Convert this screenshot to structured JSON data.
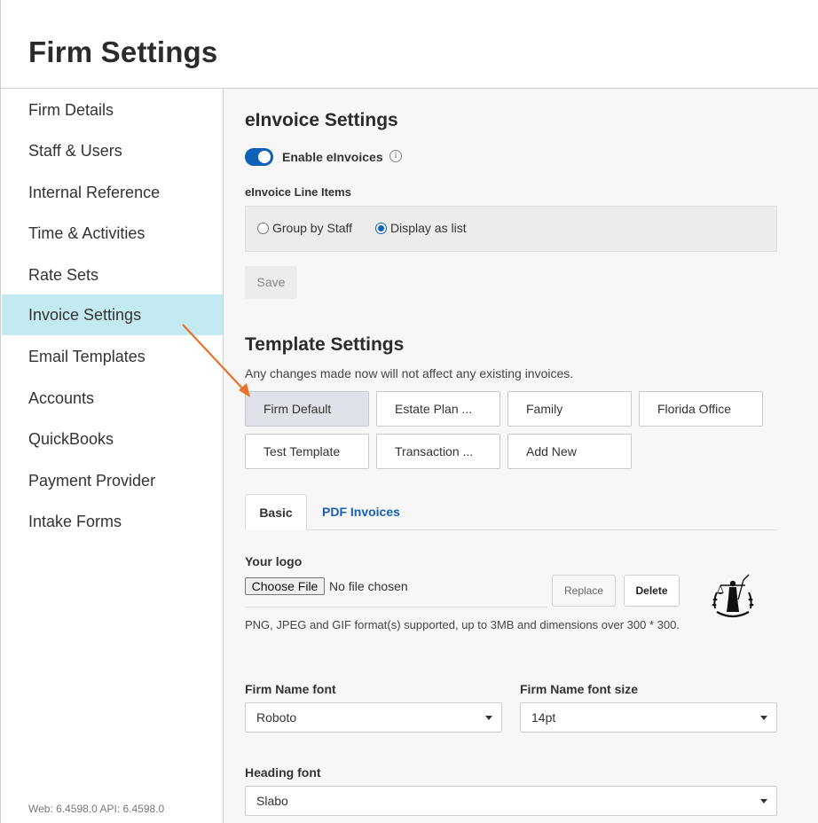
{
  "header": {
    "title": "Firm Settings"
  },
  "sidebar": {
    "items": [
      {
        "label": "Firm Details",
        "active": false
      },
      {
        "label": "Staff & Users",
        "active": false
      },
      {
        "label": "Internal Reference",
        "active": false
      },
      {
        "label": "Time & Activities",
        "active": false
      },
      {
        "label": "Rate Sets",
        "active": false
      },
      {
        "label": "Invoice Settings",
        "active": true
      },
      {
        "label": "Email Templates",
        "active": false
      },
      {
        "label": "Accounts",
        "active": false
      },
      {
        "label": "QuickBooks",
        "active": false
      },
      {
        "label": "Payment Provider",
        "active": false
      },
      {
        "label": "Intake Forms",
        "active": false
      }
    ],
    "version": "Web: 6.4598.0 API: 6.4598.0"
  },
  "einvoice": {
    "title": "eInvoice Settings",
    "enable_label": "Enable eInvoices",
    "enabled": true,
    "info_icon": "info-icon",
    "line_items_label": "eInvoice Line Items",
    "options": [
      {
        "label": "Group by Staff",
        "checked": false
      },
      {
        "label": "Display as list",
        "checked": true
      }
    ],
    "save_label": "Save"
  },
  "templates": {
    "title": "Template Settings",
    "note": "Any changes made now will not affect any existing invoices.",
    "buttons": [
      "Firm Default",
      "Estate Plan ...",
      "Family",
      "Florida Office",
      "Test Template",
      "Transaction ...",
      "Add New"
    ],
    "selected": "Firm Default"
  },
  "tabs": [
    {
      "label": "Basic",
      "active": true
    },
    {
      "label": "PDF Invoices",
      "active": false
    }
  ],
  "logo": {
    "label": "Your logo",
    "choose_label": "Choose File",
    "file_status": "No file chosen",
    "replace_label": "Replace",
    "delete_label": "Delete",
    "hint": "PNG, JPEG and GIF format(s) supported, up to 3MB and dimensions over 300 * 300."
  },
  "fonts": {
    "firm_name_font_label": "Firm Name font",
    "firm_name_font_value": "Roboto",
    "firm_name_size_label": "Firm Name font size",
    "firm_name_size_value": "14pt",
    "heading_font_label": "Heading font",
    "heading_font_value": "Slabo"
  },
  "colors": {
    "accent": "#0e60b8",
    "active_nav": "#c4eaf1",
    "arrow": "#e8722a",
    "link": "#1a5fb4"
  }
}
